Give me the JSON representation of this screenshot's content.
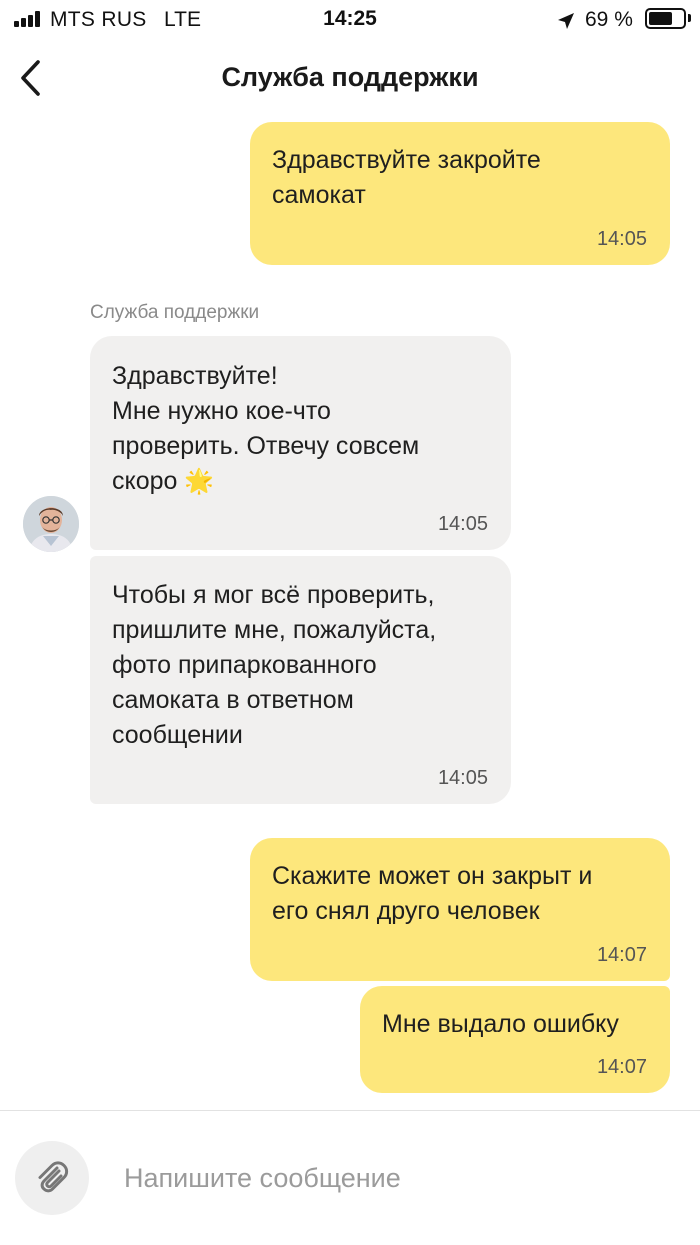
{
  "status_bar": {
    "carrier": "MTS RUS",
    "network": "LTE",
    "time": "14:25",
    "battery_percent": "69 %",
    "battery_level": 0.69
  },
  "nav": {
    "title": "Служба поддержки",
    "back_icon": "chevron-left-icon"
  },
  "chat": {
    "sender_name": "Служба поддержки",
    "messages": [
      {
        "direction": "outgoing",
        "text": "Здравствуйте закройте\nсамокат",
        "time": "14:05"
      },
      {
        "direction": "incoming",
        "text": "Здравствуйте!\nМне нужно кое-что\nпроверить. Отвечу совсем\nскоро",
        "emoji": "🌟",
        "time": "14:05"
      },
      {
        "direction": "incoming",
        "text": "Чтобы я мог всё проверить,\nпришлите мне, пожалуйста,\nфото припаркованного\nсамоката в ответном\nсообщении",
        "time": "14:05"
      },
      {
        "direction": "outgoing",
        "text": "Скажите может он закрыт и\nего снял друго человек",
        "time": "14:07"
      },
      {
        "direction": "outgoing",
        "text": "Мне выдало ошибку",
        "time": "14:07"
      }
    ]
  },
  "composer": {
    "placeholder": "Напишите сообщение",
    "attach_icon": "paperclip-icon"
  },
  "colors": {
    "outgoing_bubble": "#fde77c",
    "incoming_bubble": "#f1f0ef"
  }
}
